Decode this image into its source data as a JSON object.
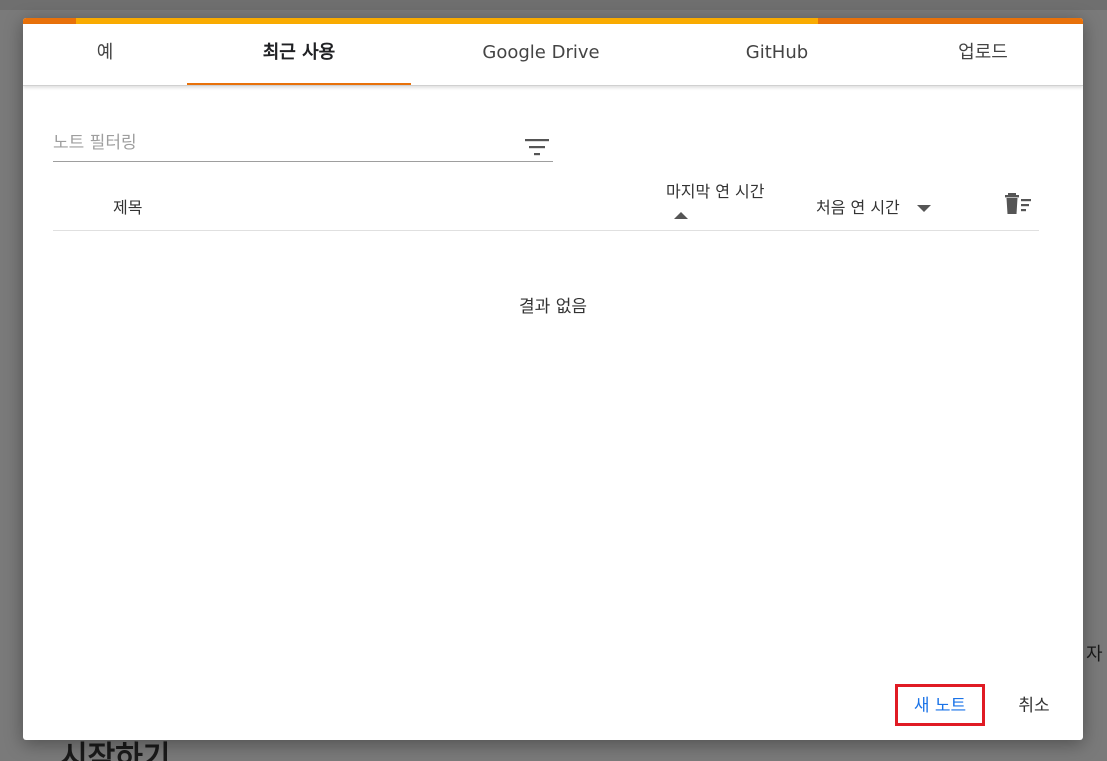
{
  "tabs": [
    {
      "label": "예",
      "active": false
    },
    {
      "label": "최근 사용",
      "active": true
    },
    {
      "label": "Google Drive",
      "active": false
    },
    {
      "label": "GitHub",
      "active": false
    },
    {
      "label": "업로드",
      "active": false
    }
  ],
  "filter": {
    "placeholder": "노트 필터링",
    "value": ""
  },
  "table": {
    "columns": {
      "title": "제목",
      "last_opened": "마지막 연 시간",
      "first_opened": "처음 연 시간"
    },
    "empty_message": "결과 없음"
  },
  "actions": {
    "new_notebook": "새 노트",
    "cancel": "취소"
  },
  "backdrop": {
    "side_text": "자",
    "bottom_text": "시작하기"
  },
  "colors": {
    "accent_orange": "#e8710a",
    "accent_yellow": "#f9ab00",
    "link_blue": "#1a73e8",
    "highlight_red": "#e01b24"
  },
  "icons": {
    "filter": "filter-list-icon",
    "trash": "delete-sweep-icon",
    "sort_asc": "arrow-up-icon",
    "sort_desc": "arrow-down-icon"
  }
}
